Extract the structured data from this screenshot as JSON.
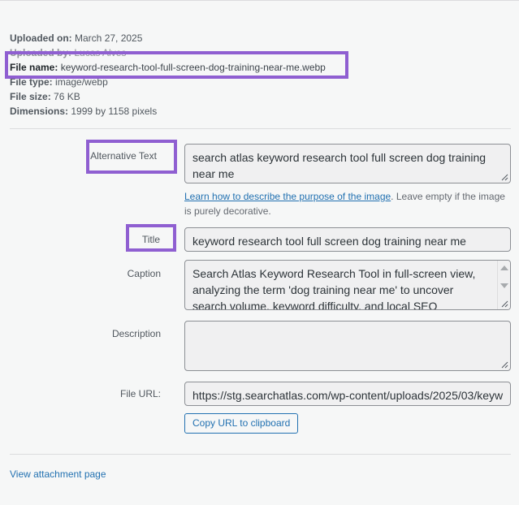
{
  "meta": {
    "uploaded_on": {
      "key": "Uploaded on:",
      "value": "March 27, 2025"
    },
    "uploaded_by": {
      "key": "Uploaded by:",
      "value": "Lucas Alves"
    },
    "file_name": {
      "key": "File name:",
      "value": "keyword-research-tool-full-screen-dog-training-near-me.webp"
    },
    "file_type": {
      "key": "File type:",
      "value": "image/webp"
    },
    "file_size": {
      "key": "File size:",
      "value": "76 KB"
    },
    "dimensions": {
      "key": "Dimensions:",
      "value": "1999 by 1158 pixels"
    }
  },
  "fields": {
    "alt_text": {
      "label": "Alternative Text",
      "value": "search atlas keyword research tool full screen dog training near me"
    },
    "alt_help": {
      "link": "Learn how to describe the purpose of the image",
      "rest": ". Leave empty if the image is purely decorative."
    },
    "title": {
      "label": "Title",
      "value": "keyword research tool full screen dog training near me"
    },
    "caption": {
      "label": "Caption",
      "value": "Search Atlas Keyword Research Tool in full-screen view, analyzing the term 'dog training near me' to uncover search volume, keyword difficulty, and local SEO"
    },
    "description": {
      "label": "Description",
      "value": ""
    },
    "file_url": {
      "label": "File URL:",
      "value": "https://stg.searchatlas.com/wp-content/uploads/2025/03/keyw"
    }
  },
  "buttons": {
    "copy_url": "Copy URL to clipboard"
  },
  "links": {
    "view_attachment": "View attachment page"
  },
  "colors": {
    "highlight": "#8f5fd1",
    "link": "#2271b1"
  }
}
